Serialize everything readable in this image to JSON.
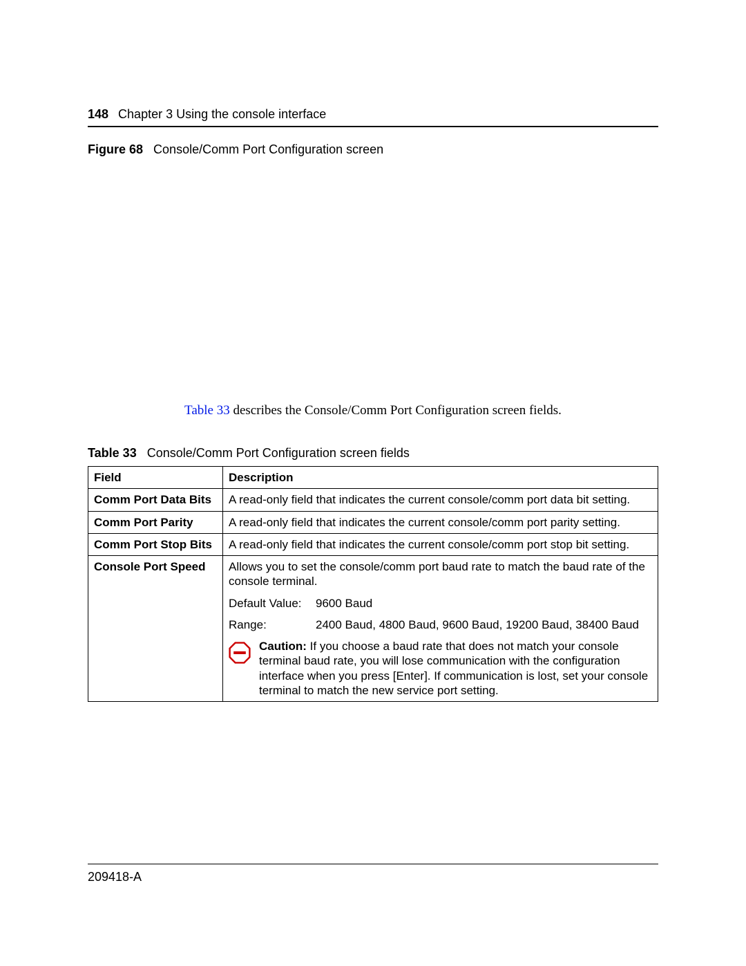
{
  "header": {
    "page_number": "148",
    "chapter": "Chapter 3  Using the console interface"
  },
  "figure": {
    "label": "Figure 68",
    "title": "Console/Comm Port Configuration screen"
  },
  "ref_sentence": {
    "link": "Table 33",
    "rest": " describes the Console/Comm Port Configuration screen fields."
  },
  "table_caption": {
    "label": "Table 33",
    "title": "Console/Comm Port Configuration screen fields"
  },
  "table": {
    "headers": {
      "field": "Field",
      "description": "Description"
    },
    "rows": [
      {
        "field": "Comm Port Data Bits",
        "desc": "A read-only field that indicates the current console/comm port data bit setting."
      },
      {
        "field": "Comm Port Parity",
        "desc": "A read-only field that indicates the current console/comm port parity setting."
      },
      {
        "field": "Comm Port Stop Bits",
        "desc": "A read-only field that indicates the current console/comm port stop bit setting."
      }
    ],
    "speed": {
      "field": "Console Port Speed",
      "desc": "Allows you to set the console/comm port baud rate to match the baud rate of the console terminal.",
      "default_label": "Default Value:",
      "default_value": "9600 Baud",
      "range_label": "Range:",
      "range_value": "2400 Baud, 4800 Baud, 9600 Baud, 19200 Baud, 38400 Baud",
      "caution_label": "Caution:",
      "caution_text": " If you choose a baud rate that does not match your console terminal baud rate, you will lose communication with the configuration interface when you press [Enter]. If communication is lost, set your console terminal to match the new service port setting."
    }
  },
  "footer": {
    "doc_id": "209418-A"
  }
}
